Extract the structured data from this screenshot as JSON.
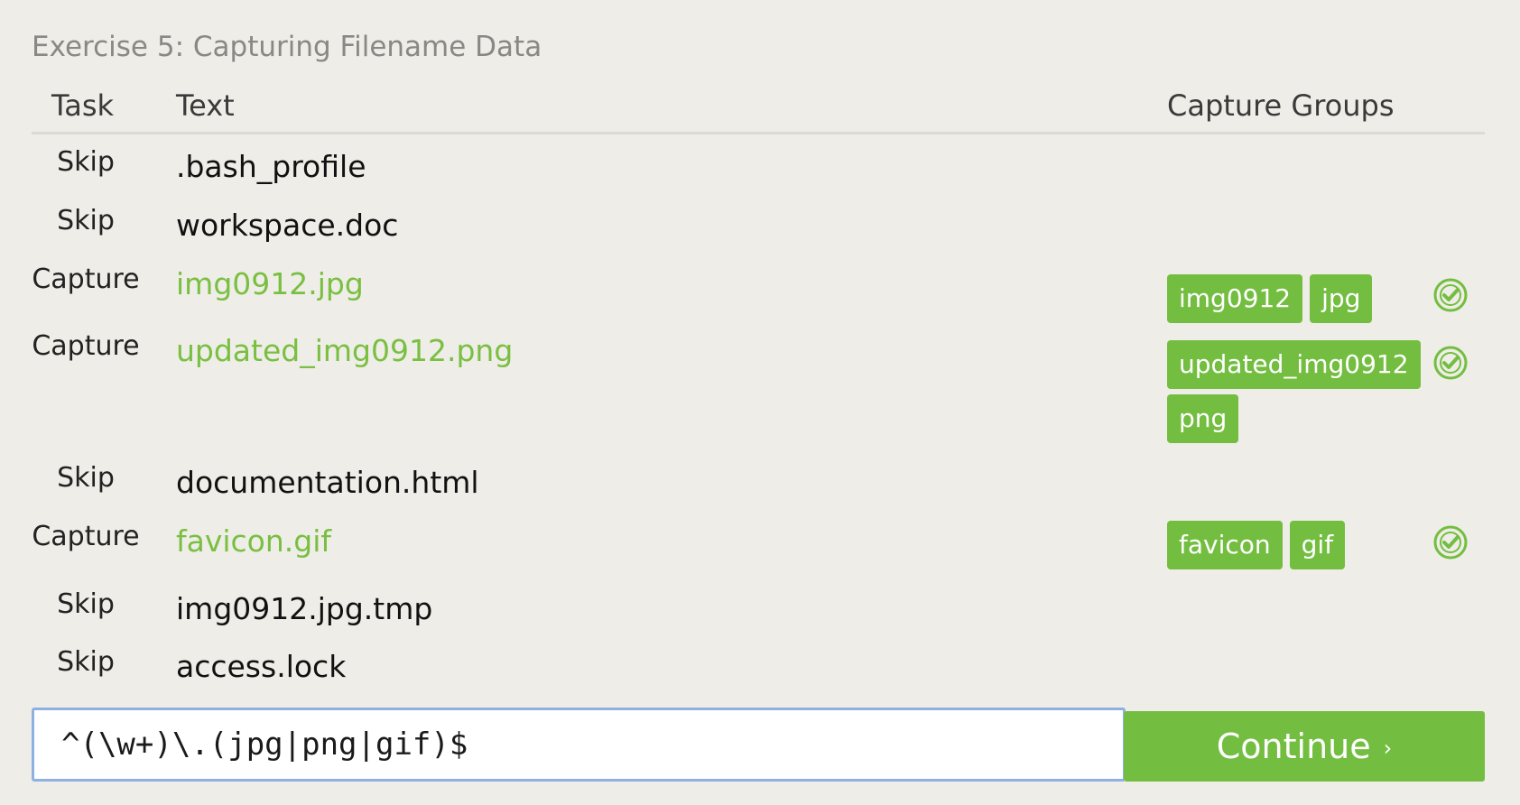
{
  "exercise": {
    "title": "Exercise 5: Capturing Filename Data"
  },
  "table": {
    "headers": {
      "task": "Task",
      "text": "Text",
      "groups": "Capture Groups"
    },
    "rows": [
      {
        "task": "Skip",
        "text": ".bash_profile",
        "match": false,
        "groups": []
      },
      {
        "task": "Skip",
        "text": "workspace.doc",
        "match": false,
        "groups": []
      },
      {
        "task": "Capture",
        "text": "img0912.jpg",
        "match": true,
        "groups": [
          "img0912",
          "jpg"
        ]
      },
      {
        "task": "Capture",
        "text": "updated_img0912.png",
        "match": true,
        "groups": [
          "updated_img0912",
          "png"
        ]
      },
      {
        "task": "Skip",
        "text": "documentation.html",
        "match": false,
        "groups": []
      },
      {
        "task": "Capture",
        "text": "favicon.gif",
        "match": true,
        "groups": [
          "favicon",
          "gif"
        ]
      },
      {
        "task": "Skip",
        "text": "img0912.jpg.tmp",
        "match": false,
        "groups": []
      },
      {
        "task": "Skip",
        "text": "access.lock",
        "match": false,
        "groups": []
      }
    ]
  },
  "input": {
    "value": "^(\\w+)\\.(jpg|png|gif)$"
  },
  "continue": {
    "label": "Continue",
    "arrow": "›"
  },
  "icons": {
    "check": "check-circle-icon"
  },
  "colors": {
    "accent_green": "#73be40",
    "match_text": "#79bf41",
    "background": "#efede7",
    "input_border": "#8fb0e3"
  }
}
